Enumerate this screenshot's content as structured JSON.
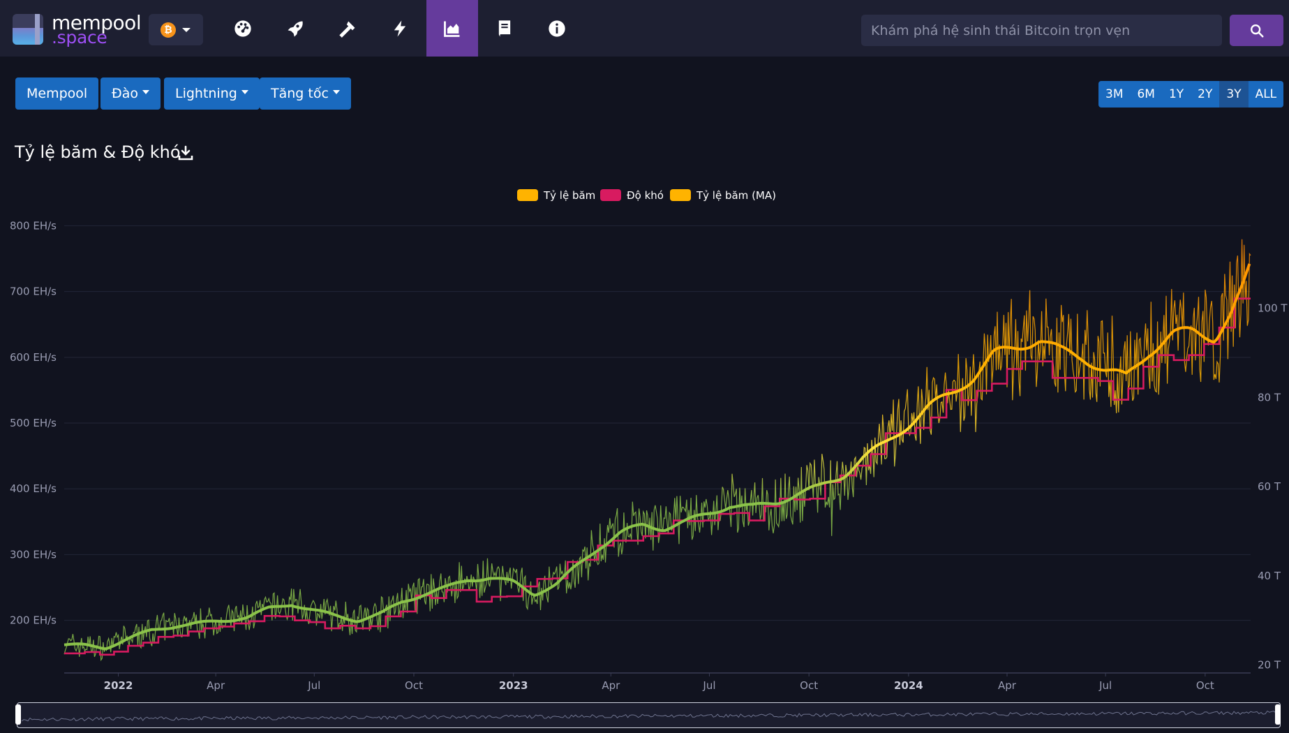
{
  "app": {
    "logo_line1": "mempool",
    "logo_line2": ".space",
    "network_symbol": "₿"
  },
  "nav": {
    "icons": [
      "dashboard-gauge-icon",
      "rocket-icon",
      "hammer-icon",
      "lightning-icon",
      "chart-area-icon",
      "book-icon",
      "info-icon"
    ],
    "active_icon": "chart-area-icon"
  },
  "search": {
    "placeholder": "Khám phá hệ sinh thái Bitcoin trọn vẹn"
  },
  "submenu": {
    "mempool": "Mempool",
    "mining": "Đào",
    "lightning": "Lightning",
    "accelerate": "Tăng tốc"
  },
  "ranges": {
    "items": [
      "3M",
      "6M",
      "1Y",
      "2Y",
      "3Y",
      "ALL"
    ],
    "selected": "3Y"
  },
  "page_title": "Tỷ lệ băm & Độ khó",
  "colors": {
    "hashrate": "#ffb300",
    "difficulty": "#d81b60",
    "hashrate_ma_green": "#8bc34a",
    "hashrate_ma_orange": "#ff9800",
    "accent_purple": "#653b9c",
    "button_blue": "#1a6abf"
  },
  "chart_data": {
    "type": "line",
    "title": "",
    "legend": [
      "Tỷ lệ băm",
      "Độ khó",
      "Tỷ lệ băm (MA)"
    ],
    "legend_position": "top-center",
    "x_range": [
      "2021-11-12",
      "2024-11-12"
    ],
    "x_tick_labels": [
      "2022",
      "Apr",
      "Jul",
      "Oct",
      "2023",
      "Apr",
      "Jul",
      "Oct",
      "2024",
      "Apr",
      "Jul",
      "Oct"
    ],
    "x_tick_dates": [
      "2022-01-01",
      "2022-04-01",
      "2022-07-01",
      "2022-10-01",
      "2023-01-01",
      "2023-04-01",
      "2023-07-01",
      "2023-10-01",
      "2024-01-01",
      "2024-04-01",
      "2024-07-01",
      "2024-10-01"
    ],
    "y_left": {
      "unit": "EH/s",
      "min": 120,
      "max": 810,
      "ticks": [
        200,
        300,
        400,
        500,
        600,
        700,
        800
      ],
      "tick_labels": [
        "200 EH/s",
        "300 EH/s",
        "400 EH/s",
        "500 EH/s",
        "600 EH/s",
        "700 EH/s",
        "800 EH/s"
      ]
    },
    "y_right": {
      "unit": "T",
      "min": 18.2,
      "max": 120,
      "ticks": [
        20,
        40,
        60,
        80,
        100
      ],
      "tick_labels": [
        "20 T",
        "40 T",
        "60 T",
        "80 T",
        "100 T"
      ]
    },
    "grid": true,
    "series": [
      {
        "name": "Tỷ lệ băm (MA)",
        "axis": "left",
        "x": [
          "2021-11-12",
          "2021-12-01",
          "2021-12-20",
          "2022-01-10",
          "2022-02-01",
          "2022-02-25",
          "2022-03-20",
          "2022-04-10",
          "2022-05-01",
          "2022-05-20",
          "2022-06-10",
          "2022-07-01",
          "2022-07-20",
          "2022-08-10",
          "2022-09-01",
          "2022-09-20",
          "2022-10-10",
          "2022-11-01",
          "2022-11-20",
          "2022-12-10",
          "2023-01-01",
          "2023-01-20",
          "2023-02-10",
          "2023-03-01",
          "2023-03-20",
          "2023-04-10",
          "2023-05-01",
          "2023-05-20",
          "2023-06-10",
          "2023-07-01",
          "2023-07-20",
          "2023-08-10",
          "2023-09-01",
          "2023-09-20",
          "2023-10-10",
          "2023-11-01",
          "2023-11-20",
          "2023-12-10",
          "2024-01-01",
          "2024-01-20",
          "2024-02-10",
          "2024-03-01",
          "2024-03-20",
          "2024-04-10",
          "2024-05-01",
          "2024-05-20",
          "2024-06-10",
          "2024-07-01",
          "2024-07-20",
          "2024-08-10",
          "2024-09-01",
          "2024-09-20",
          "2024-10-10",
          "2024-10-25",
          "2024-11-05",
          "2024-11-12"
        ],
        "values": [
          163,
          162,
          158,
          172,
          185,
          192,
          196,
          200,
          205,
          218,
          225,
          215,
          207,
          200,
          210,
          228,
          240,
          250,
          262,
          265,
          258,
          240,
          255,
          283,
          310,
          333,
          345,
          340,
          350,
          363,
          375,
          372,
          380,
          392,
          402,
          420,
          447,
          468,
          498,
          525,
          545,
          570,
          605,
          615,
          628,
          610,
          600,
          580,
          570,
          608,
          635,
          640,
          630,
          665,
          705,
          740
        ]
      },
      {
        "name": "Độ khó",
        "axis": "right",
        "x": [
          "2021-11-12",
          "2021-12-01",
          "2021-12-15",
          "2021-12-28",
          "2022-01-10",
          "2022-01-24",
          "2022-02-07",
          "2022-02-21",
          "2022-03-07",
          "2022-03-21",
          "2022-04-04",
          "2022-04-18",
          "2022-05-02",
          "2022-05-16",
          "2022-05-30",
          "2022-06-13",
          "2022-06-27",
          "2022-07-11",
          "2022-07-25",
          "2022-08-08",
          "2022-08-22",
          "2022-09-05",
          "2022-09-19",
          "2022-10-03",
          "2022-10-17",
          "2022-10-31",
          "2022-11-14",
          "2022-11-28",
          "2022-12-12",
          "2022-12-26",
          "2023-01-09",
          "2023-01-23",
          "2023-02-06",
          "2023-02-20",
          "2023-03-06",
          "2023-03-20",
          "2023-04-03",
          "2023-04-17",
          "2023-05-01",
          "2023-05-15",
          "2023-05-29",
          "2023-06-12",
          "2023-06-26",
          "2023-07-10",
          "2023-07-24",
          "2023-08-07",
          "2023-08-21",
          "2023-09-04",
          "2023-09-18",
          "2023-10-02",
          "2023-10-16",
          "2023-10-30",
          "2023-11-13",
          "2023-11-27",
          "2023-12-11",
          "2023-12-25",
          "2024-01-08",
          "2024-01-22",
          "2024-02-05",
          "2024-02-19",
          "2024-03-04",
          "2024-03-18",
          "2024-04-01",
          "2024-04-15",
          "2024-04-29",
          "2024-05-13",
          "2024-05-27",
          "2024-06-10",
          "2024-06-24",
          "2024-07-08",
          "2024-07-22",
          "2024-08-05",
          "2024-08-19",
          "2024-09-02",
          "2024-09-16",
          "2024-09-30",
          "2024-10-14",
          "2024-10-28",
          "2024-11-12"
        ],
        "values": [
          22.6,
          22.9,
          22.3,
          23.0,
          24.3,
          25.0,
          26.3,
          26.6,
          27.5,
          28.2,
          28.6,
          29.3,
          29.8,
          31.0,
          30.9,
          30.0,
          29.6,
          28.2,
          28.8,
          28.2,
          28.7,
          30.9,
          32.0,
          35.6,
          35.0,
          36.8,
          36.8,
          34.2,
          35.3,
          35.4,
          37.6,
          39.3,
          39.4,
          43.1,
          43.6,
          46.8,
          47.9,
          47.9,
          48.9,
          49.5,
          52.4,
          52.3,
          52.4,
          53.9,
          54.1,
          52.4,
          55.6,
          57.3,
          57.1,
          57.3,
          61.0,
          62.5,
          64.7,
          67.3,
          72.0,
          72.0,
          73.2,
          75.5,
          81.7,
          79.4,
          81.5,
          83.1,
          86.4,
          88.1,
          88.1,
          84.4,
          84.4,
          84.4,
          83.7,
          79.5,
          82.0,
          86.9,
          89.5,
          88.4,
          89.5,
          92.0,
          95.7,
          102.2,
          102.2
        ]
      },
      {
        "name": "Tỷ lệ băm",
        "axis": "left",
        "note_values": "daily raw hashrate, noisy around MA; peaks near 810 EH/s in late Oct 2024"
      }
    ]
  }
}
